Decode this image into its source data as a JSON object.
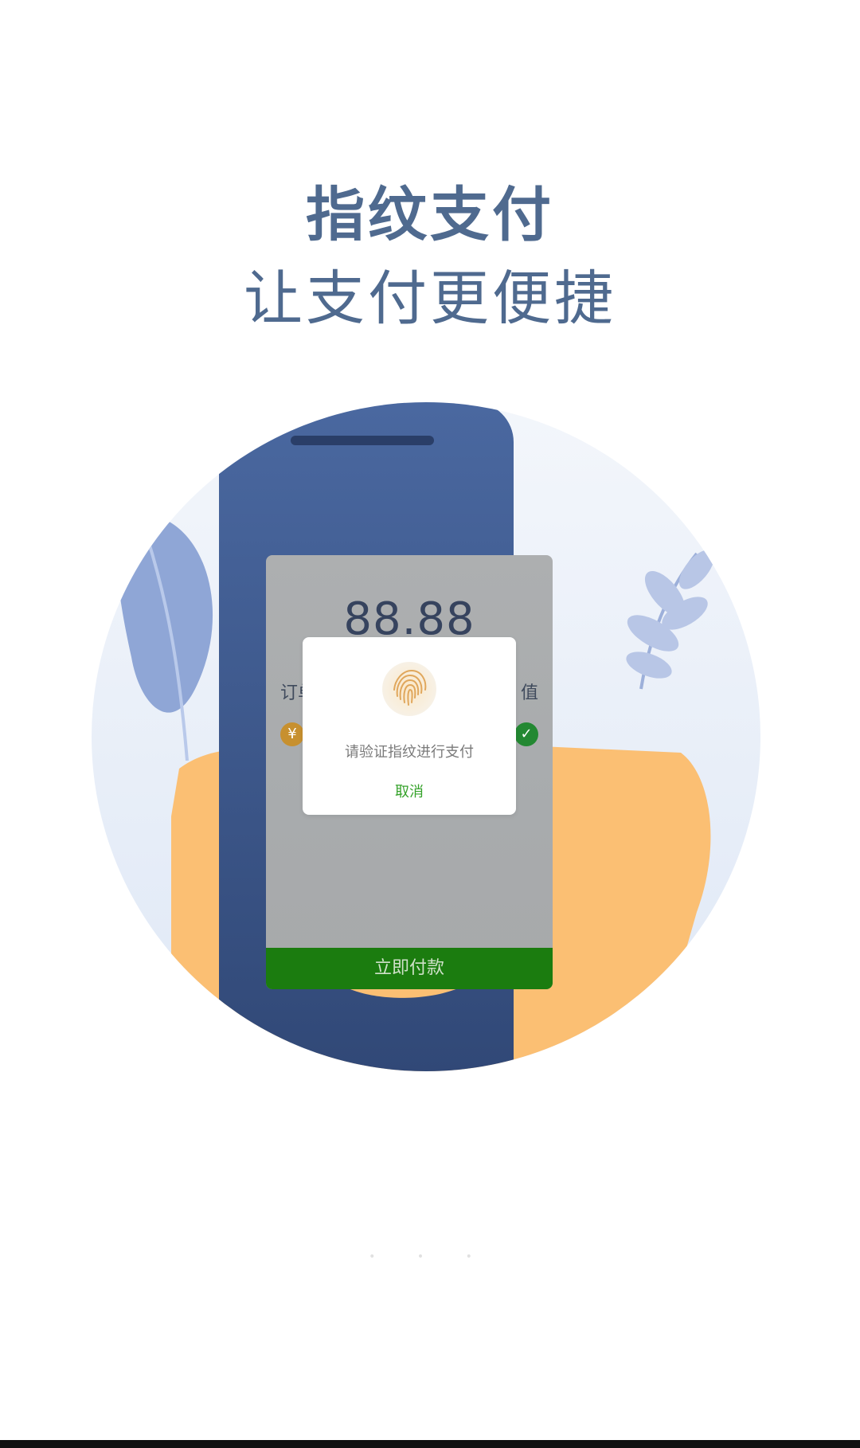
{
  "headline": {
    "title": "指纹支付",
    "subtitle": "让支付更便捷"
  },
  "phone": {
    "amount": "88.88",
    "left_label": "订单",
    "right_label": "值",
    "coin_symbol": "¥",
    "check_symbol": "✓",
    "pay_button": "立即付款"
  },
  "dialog": {
    "prompt": "请验证指纹进行支付",
    "cancel": "取消"
  },
  "colors": {
    "headline": "#4f6a8f",
    "phone_body": "#3c5687",
    "pay_green": "#1b7c0f",
    "cancel_green": "#35a22a",
    "hand": "#fbbf73"
  }
}
